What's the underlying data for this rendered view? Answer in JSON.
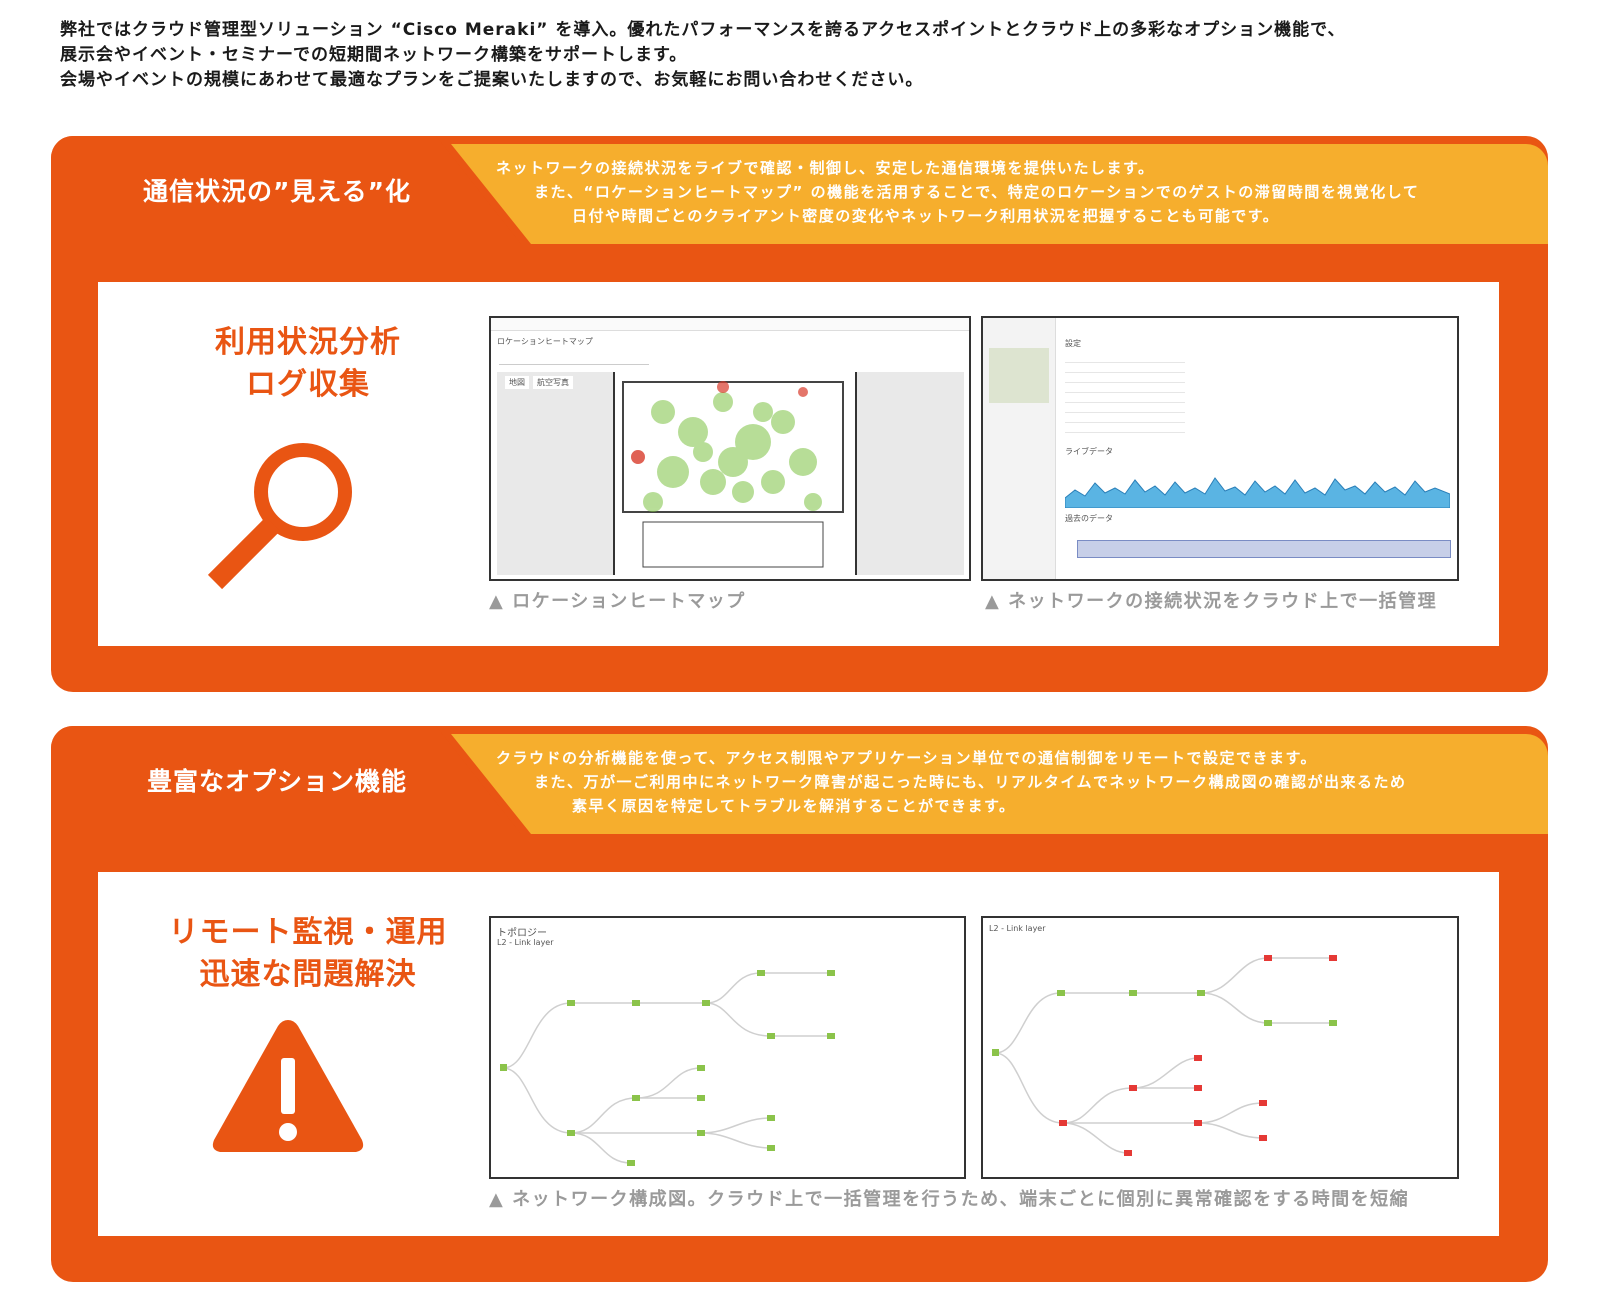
{
  "intro": {
    "line1": "弊社ではクラウド管理型ソリューション “Cisco Meraki” を導入。優れたパフォーマンスを誇るアクセスポイントとクラウド上の多彩なオプション機能で、",
    "line2": "展示会やイベント・セミナーでの短期間ネットワーク構築をサポートします。",
    "line3": "会場やイベントの規模にあわせて最適なプランをご提案いたしますので、お気軽にお問い合わせください。"
  },
  "section1": {
    "title": "通信状況の”見える”化",
    "desc": [
      "ネットワークの接続状況をライブで確認・制御し、安定した通信環境を提供いたします。",
      "また、“ロケーションヒートマップ” の機能を活用することで、特定のロケーションでのゲストの滞留時間を視覚化して",
      "日付や時間ごとのクライアント密度の変化やネットワーク利用状況を把握することも可能です。"
    ],
    "feature_title": [
      "利用状況分析",
      "ログ収集"
    ],
    "icon": "search-icon",
    "screenshot1": {
      "heading": "ロケーションヒートマップ",
      "tab_map": "地図",
      "tab_satellite": "航空写真",
      "caption": "▲ ロケーションヒートマップ"
    },
    "screenshot2": {
      "heading": "設定",
      "live_label": "ライブデータ",
      "history_label": "過去のデータ",
      "caption": "▲ ネットワークの接続状況をクラウド上で一括管理"
    }
  },
  "section2": {
    "title": "豊富なオプション機能",
    "desc": [
      "クラウドの分析機能を使って、アクセス制限やアプリケーション単位での通信制御をリモートで設定できます。",
      "また、万が一ご利用中にネットワーク障害が起こった時にも、リアルタイムでネットワーク構成図の確認が出来るため",
      "素早く原因を特定してトラブルを解消することができます。"
    ],
    "feature_title": [
      "リモート監視・運用",
      "迅速な問題解決"
    ],
    "icon": "warning-icon",
    "screenshot1": {
      "heading": "トポロジー",
      "tab": "L2 - Link layer"
    },
    "screenshot2": {
      "tab": "L2 - Link layer"
    },
    "caption": "▲ ネットワーク構成図。クラウド上で一括管理を行うため、端末ごとに個別に異常確認をする時間を短縮"
  },
  "colors": {
    "orange": "#e95513",
    "yellow": "#f6ae2d"
  }
}
